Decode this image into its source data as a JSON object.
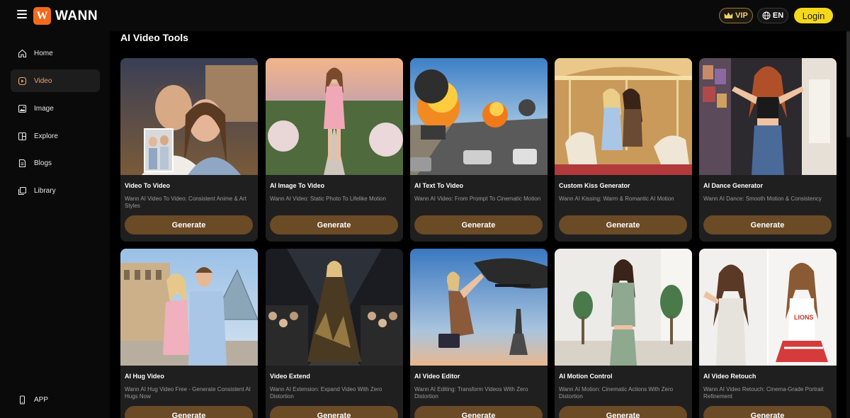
{
  "header": {
    "logo_text": "WANN",
    "logo_mark": "W",
    "vip_label": "VIP",
    "lang_label": "EN",
    "login_label": "Login"
  },
  "sidebar": {
    "items": [
      {
        "label": "Home",
        "icon": "home-icon",
        "active": false
      },
      {
        "label": "Video",
        "icon": "video-icon",
        "active": true
      },
      {
        "label": "Image",
        "icon": "image-icon",
        "active": false
      },
      {
        "label": "Explore",
        "icon": "explore-icon",
        "active": false
      },
      {
        "label": "Blogs",
        "icon": "blogs-icon",
        "active": false
      },
      {
        "label": "Library",
        "icon": "library-icon",
        "active": false
      }
    ],
    "app_label": "APP"
  },
  "main": {
    "section_title": "AI Video Tools",
    "generate_label": "Generate",
    "cards": [
      {
        "title": "Video To Video",
        "desc": "Wann AI Video To Video: Consistent Anime & Art Styles"
      },
      {
        "title": "AI Image To Video",
        "desc": "Wann AI Video: Static Photo To Lifelike Motion"
      },
      {
        "title": "AI Text To Video",
        "desc": "Wann AI Video: From Prompt To Cinematic Motion"
      },
      {
        "title": "Custom Kiss Generator",
        "desc": "Wann AI Kissing: Warm & Romantic AI Motion"
      },
      {
        "title": "AI Dance Generator",
        "desc": "Wann AI Dance: Smooth Motion & Consistency"
      },
      {
        "title": "AI Hug Video",
        "desc": "Wann AI Hug Video Free - Generate Consistent AI Hugs Now"
      },
      {
        "title": "Video Extend",
        "desc": "Wann AI Extension: Expand Video With Zero Distortion"
      },
      {
        "title": "AI Video Editor",
        "desc": "Wann AI Editing: Transform Videos With Zero Distortion"
      },
      {
        "title": "AI Motion Control",
        "desc": "Wann AI Motion: Cinematic Actions With Zero Distortion"
      },
      {
        "title": "AI Video Retouch",
        "desc": "Wann AI Video Retouch: Cinema-Grade Portrait Refinement"
      }
    ]
  },
  "colors": {
    "accent": "#f26a1b",
    "login": "#f5d81c",
    "generate": "#6b4a26",
    "active_nav": "#f0a36a"
  }
}
